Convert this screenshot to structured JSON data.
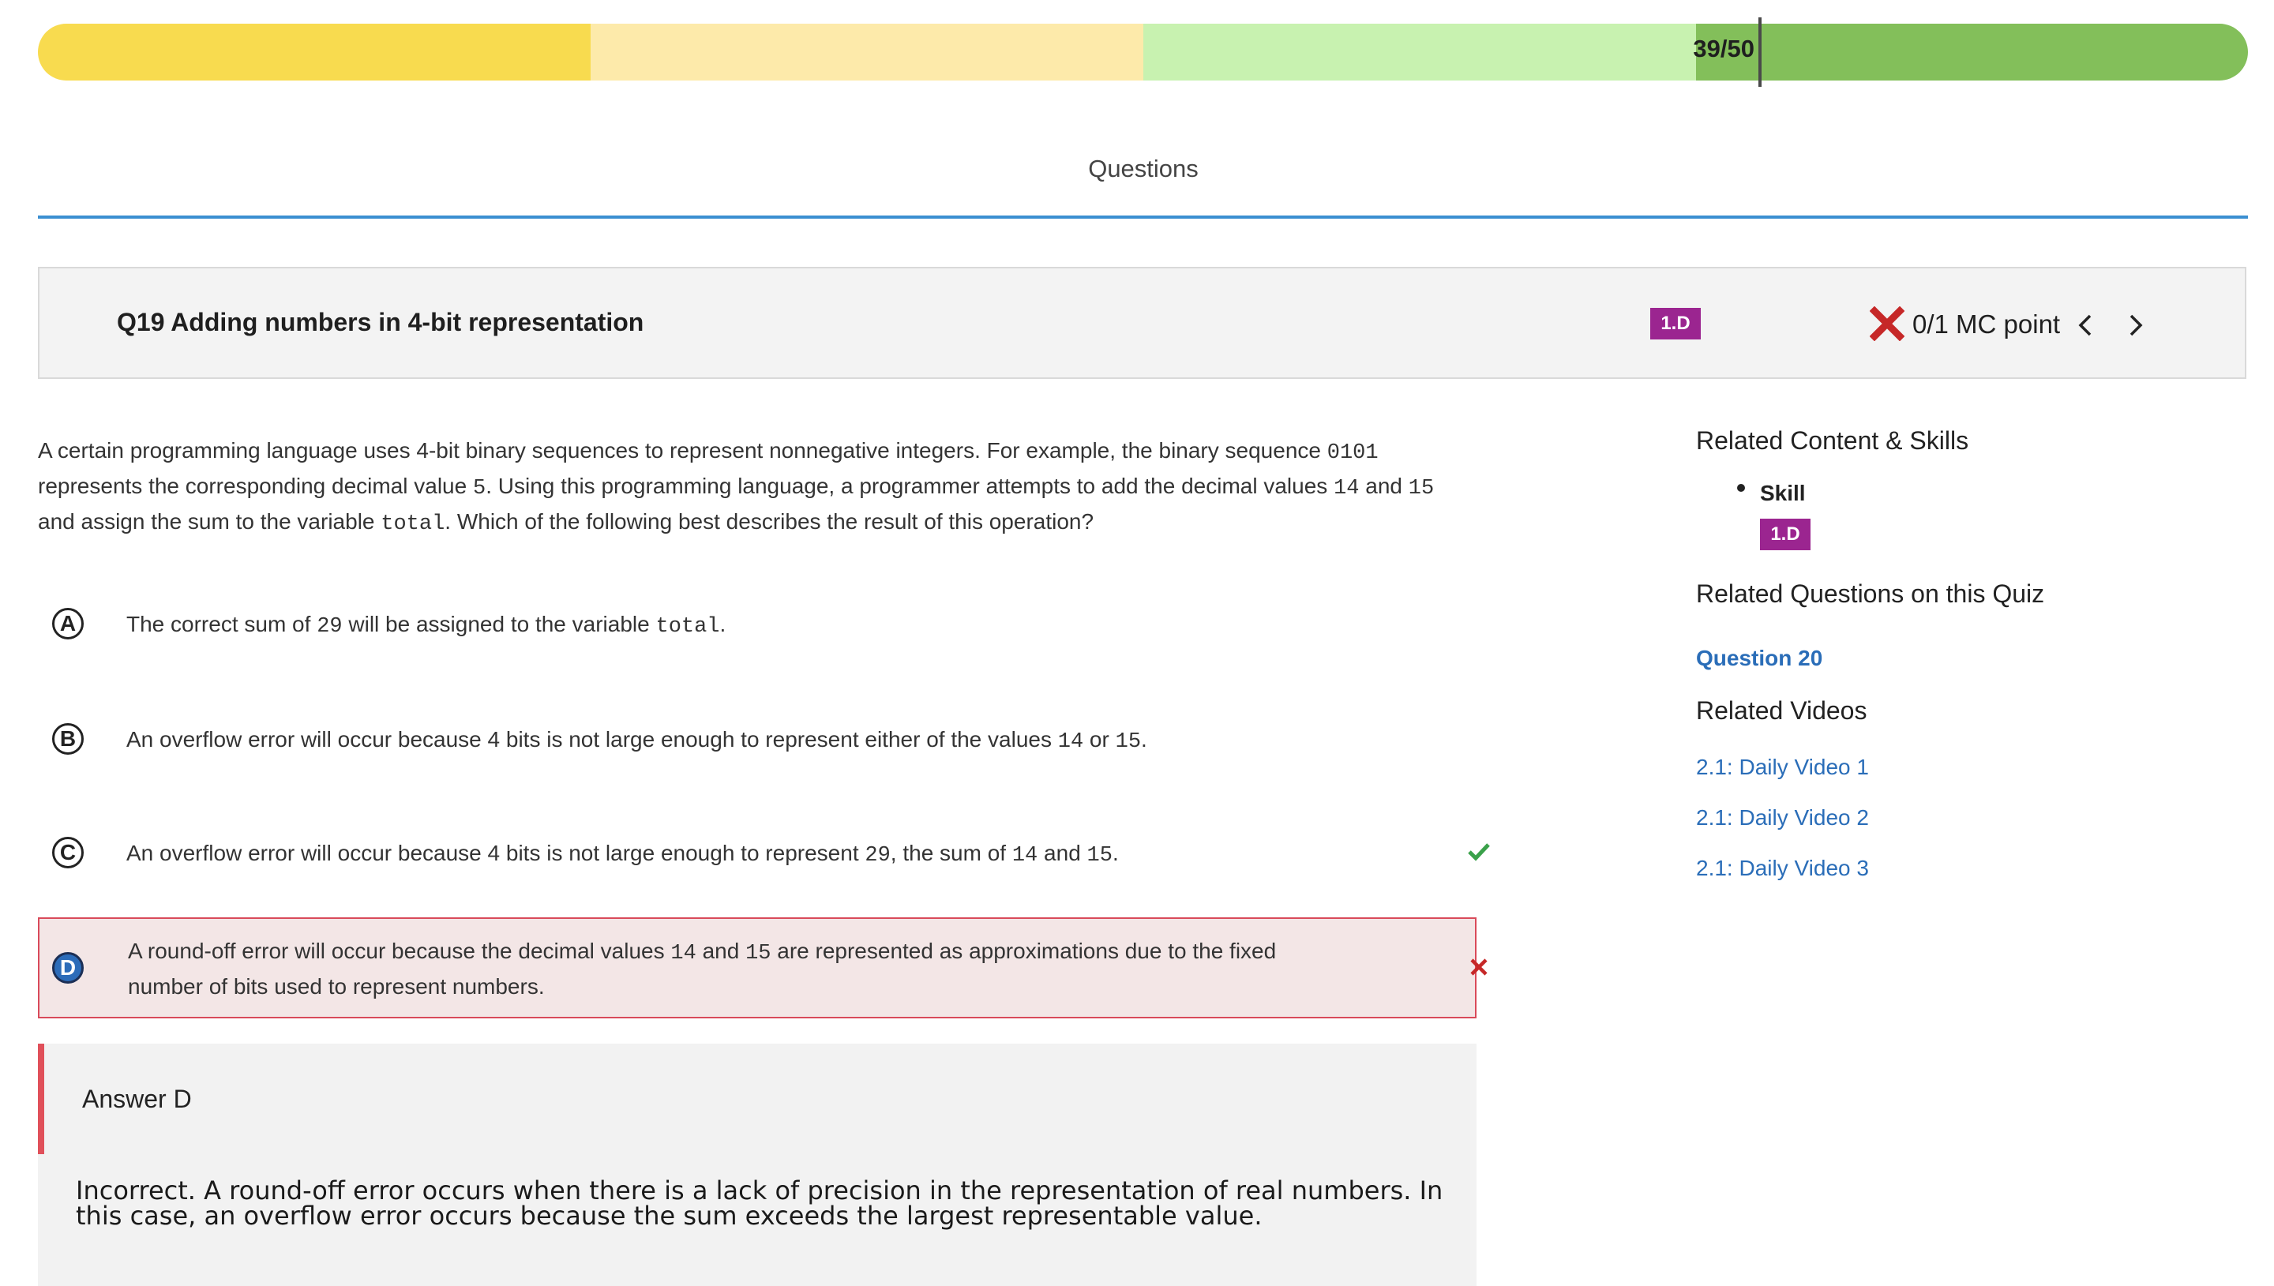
{
  "progress": {
    "label": "39/50",
    "value": 39,
    "total": 50,
    "colors": [
      "#f8db4f",
      "#fdeaaa",
      "#c8f2b0",
      "#83bf5a"
    ]
  },
  "tabs": {
    "active": "Questions"
  },
  "question": {
    "title": "Q19 Adding numbers in 4-bit representation",
    "skill_badge": "1.D",
    "score_text": "0/1 MC point",
    "score_status_icon": "x-icon",
    "stem": {
      "p1": "A certain programming language uses 4-bit binary sequences to represent nonnegative integers. For example, the binary sequence ",
      "c1": "0101",
      "p2": " represents the corresponding decimal value ",
      "c2": "5",
      "p3": ". Using this programming language, a programmer attempts to add the decimal values ",
      "c3": "14",
      "p4": " and ",
      "c4": "15",
      "p5": " and assign the sum to the variable ",
      "c5": "total",
      "p6": ". Which of the following best describes the result of this operation?"
    }
  },
  "options": {
    "a": {
      "letter": "A",
      "t1": "The correct sum of ",
      "c1": "29",
      "t2": " will be assigned to the variable ",
      "c2": "total",
      "t3": "."
    },
    "b": {
      "letter": "B",
      "t1": "An overflow error will occur because 4 bits is not large enough to represent either of the values ",
      "c1": "14",
      "t2": " or ",
      "c2": "15",
      "t3": "."
    },
    "c": {
      "letter": "C",
      "t1": "An overflow error will occur because 4 bits is not large enough to represent ",
      "c1": "29",
      "t2": ", the sum of ",
      "c2": "14",
      "t3": " and ",
      "c3": "15",
      "t4": ".",
      "status": "correct"
    },
    "d": {
      "letter": "D",
      "t1": "A round-off error will occur because the decimal values ",
      "c1": "14",
      "t2": " and ",
      "c2": "15",
      "t3": " are represented as approximations due to the fixed number of bits used to represent numbers.",
      "status": "selected-incorrect"
    }
  },
  "answer": {
    "title": "Answer D",
    "explanation": "Incorrect. A round-off error occurs when there is a lack of precision in the representation of real numbers. In this case, an overflow error occurs because the sum exceeds the largest representable value."
  },
  "sidebar": {
    "related_content_heading": "Related Content & Skills",
    "skill_label": "Skill",
    "skill_badge": "1.D",
    "related_questions_heading": "Related Questions on this Quiz",
    "related_questions": [
      "Question 20"
    ],
    "related_videos_heading": "Related Videos",
    "related_videos": [
      "2.1: Daily Video 1",
      "2.1: Daily Video 2",
      "2.1: Daily Video 3"
    ]
  },
  "colors": {
    "badge": "#9b2590",
    "link": "#2a6db8",
    "incorrect": "#c62828",
    "correct": "#3aa14a",
    "tab_underline": "#3b8fd1"
  }
}
